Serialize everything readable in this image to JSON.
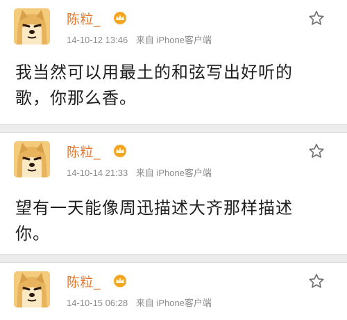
{
  "posts": [
    {
      "username": "陈粒_",
      "timestamp": "14-10-12 13:46",
      "source": "来自 iPhone客户端",
      "text": "我当然可以用最土的和弦写出好听的\n歌，你那么香。"
    },
    {
      "username": "陈粒_",
      "timestamp": "14-10-14 21:33",
      "source": "来自 iPhone客户端",
      "text": "望有一天能像周迅描述大齐那样描述\n你。"
    },
    {
      "username": "陈粒_",
      "timestamp": "14-10-15 06:28",
      "source": "来自 iPhone客户端",
      "text": ""
    }
  ],
  "icons": {
    "avatar": "shiba-doge-avatar",
    "vip": "crown-vip-icon",
    "favorite": "star-outline-icon"
  },
  "colors": {
    "username": "#e2762b",
    "meta": "#8c8c8c",
    "text": "#1e1e1e",
    "separator": "#ececec"
  }
}
